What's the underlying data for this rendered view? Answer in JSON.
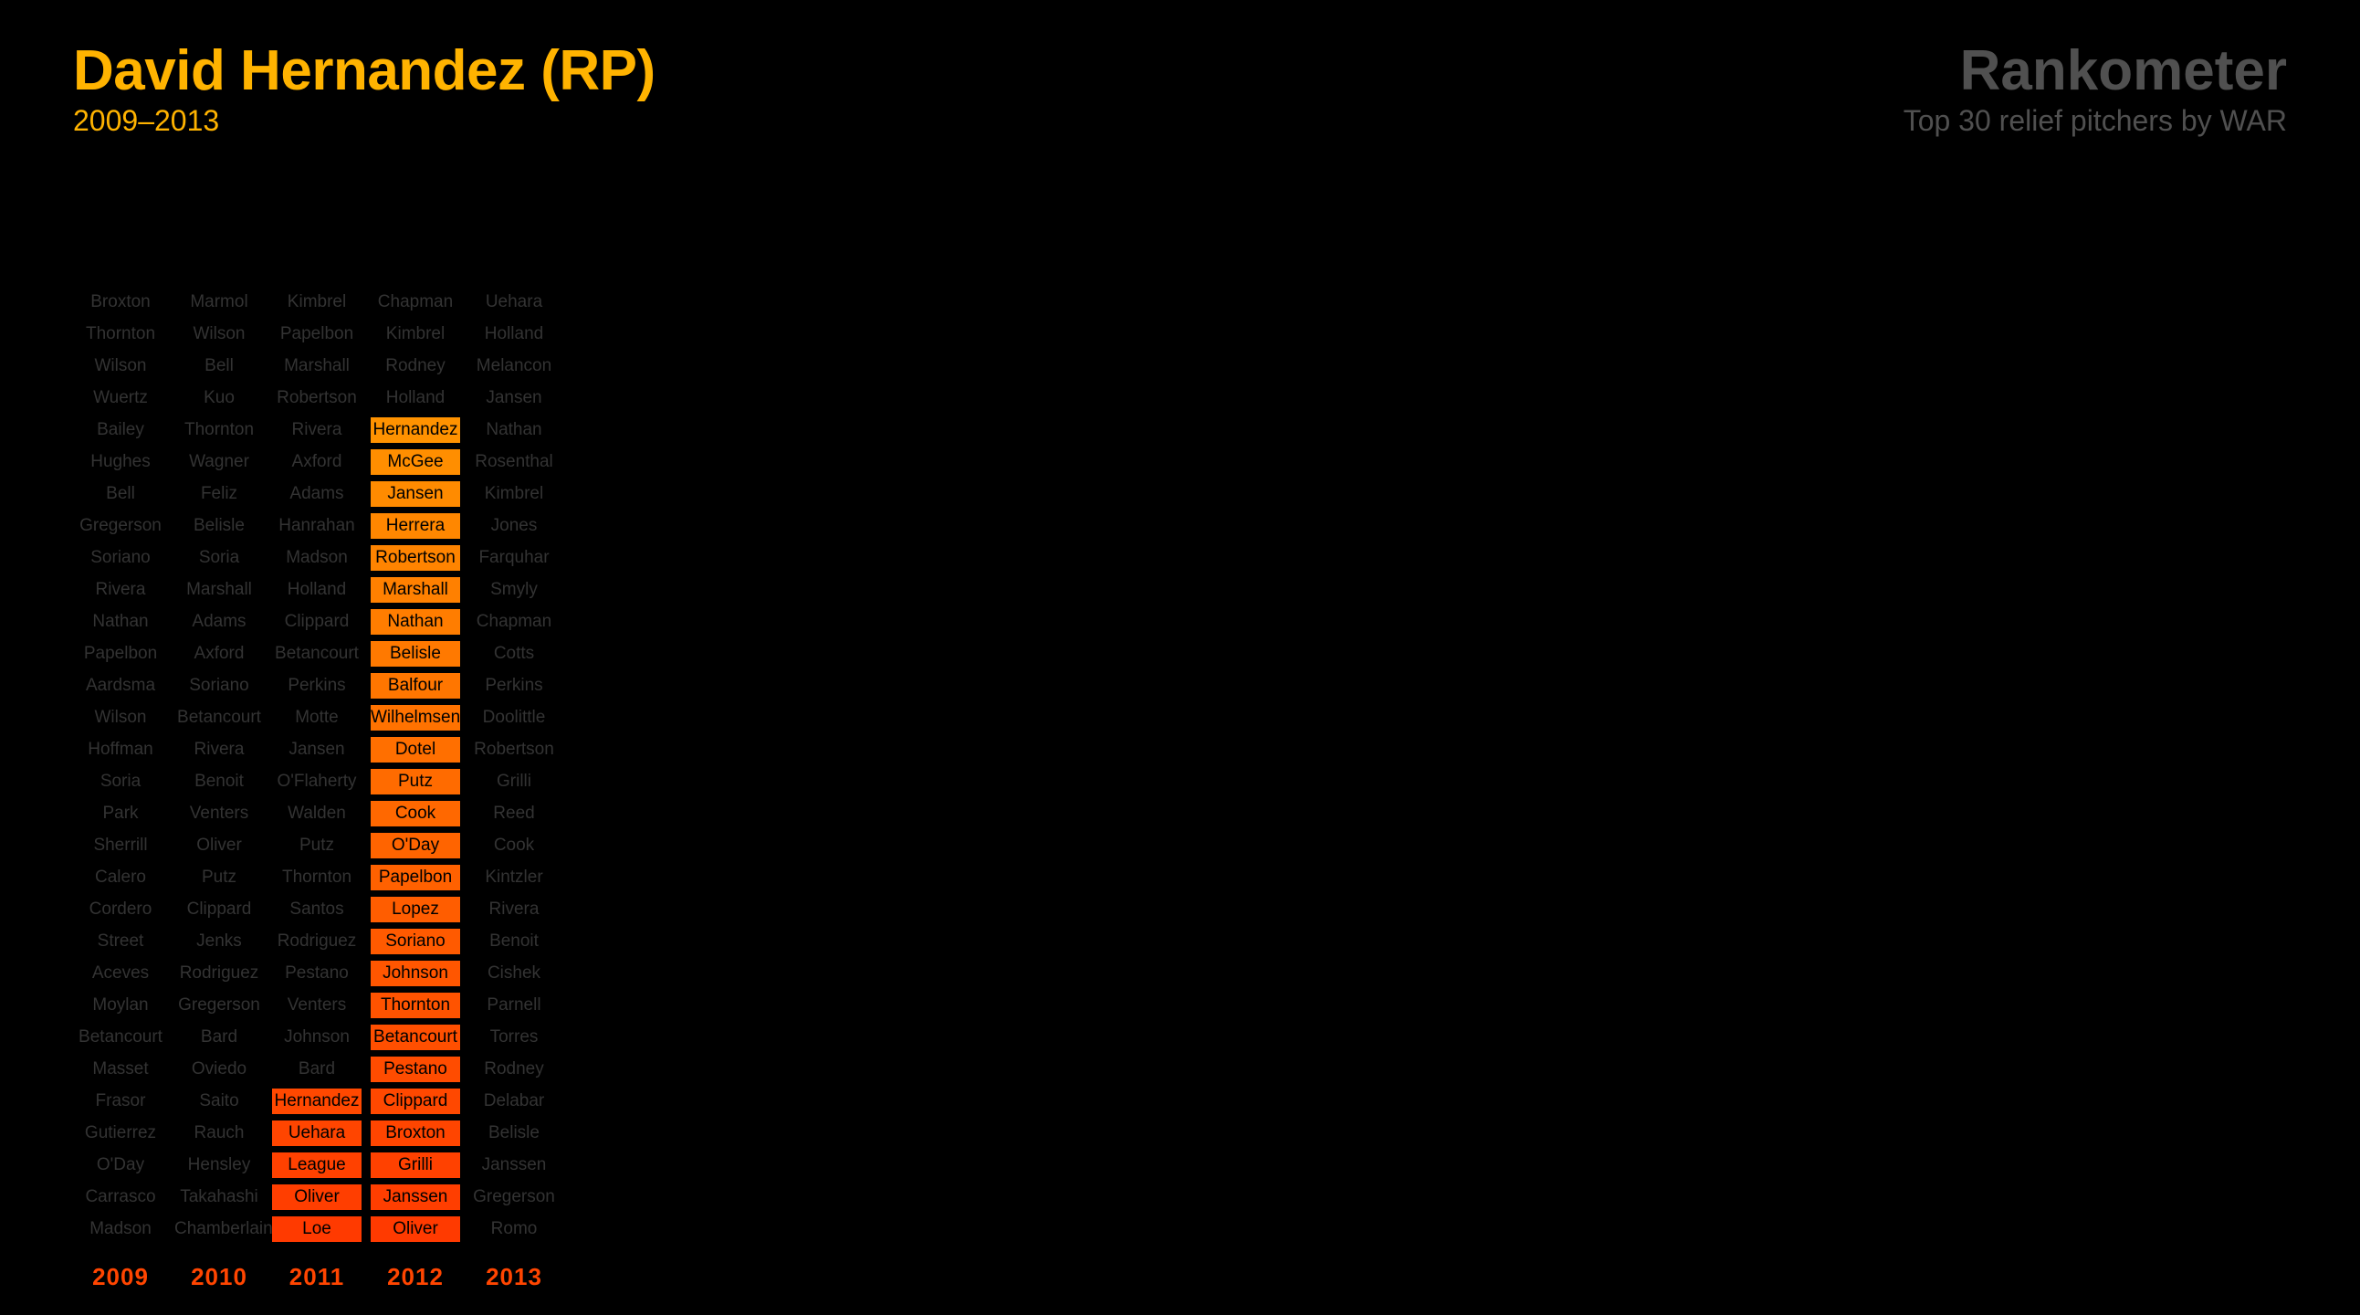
{
  "header": {
    "title": "David Hernandez (RP)",
    "subtitle": "2009–2013",
    "brand": "Rankometer",
    "tagline": "Top 30 relief pitchers by WAR"
  },
  "colors": {
    "title": "#ffb300",
    "muted_text": "#333333",
    "brand": "#505050",
    "highlight_top": "#ffa000",
    "highlight_bottom": "#ff3a00",
    "year_label": "#ff4500"
  },
  "chart_data": {
    "type": "table",
    "highlight_player": "Hernandez",
    "years": [
      "2009",
      "2010",
      "2011",
      "2012",
      "2013"
    ],
    "rankings": {
      "2009": [
        "Broxton",
        "Thornton",
        "Wilson",
        "Wuertz",
        "Bailey",
        "Hughes",
        "Bell",
        "Gregerson",
        "Soriano",
        "Rivera",
        "Nathan",
        "Papelbon",
        "Aardsma",
        "Wilson",
        "Hoffman",
        "Soria",
        "Park",
        "Sherrill",
        "Calero",
        "Cordero",
        "Street",
        "Aceves",
        "Moylan",
        "Betancourt",
        "Masset",
        "Frasor",
        "Gutierrez",
        "O'Day",
        "Carrasco",
        "Madson"
      ],
      "2010": [
        "Marmol",
        "Wilson",
        "Bell",
        "Kuo",
        "Thornton",
        "Wagner",
        "Feliz",
        "Belisle",
        "Soria",
        "Marshall",
        "Adams",
        "Axford",
        "Soriano",
        "Betancourt",
        "Rivera",
        "Benoit",
        "Venters",
        "Oliver",
        "Putz",
        "Clippard",
        "Jenks",
        "Rodriguez",
        "Gregerson",
        "Bard",
        "Oviedo",
        "Saito",
        "Rauch",
        "Hensley",
        "Takahashi",
        "Chamberlain"
      ],
      "2011": [
        "Kimbrel",
        "Papelbon",
        "Marshall",
        "Robertson",
        "Rivera",
        "Axford",
        "Adams",
        "Hanrahan",
        "Madson",
        "Holland",
        "Clippard",
        "Betancourt",
        "Perkins",
        "Motte",
        "Jansen",
        "O'Flaherty",
        "Walden",
        "Putz",
        "Thornton",
        "Santos",
        "Rodriguez",
        "Pestano",
        "Venters",
        "Johnson",
        "Bard",
        "Hernandez",
        "Uehara",
        "League",
        "Oliver",
        "Loe"
      ],
      "2012": [
        "Chapman",
        "Kimbrel",
        "Rodney",
        "Holland",
        "Hernandez",
        "McGee",
        "Jansen",
        "Herrera",
        "Robertson",
        "Marshall",
        "Nathan",
        "Belisle",
        "Balfour",
        "Wilhelmsen",
        "Dotel",
        "Putz",
        "Cook",
        "O'Day",
        "Papelbon",
        "Lopez",
        "Soriano",
        "Johnson",
        "Thornton",
        "Betancourt",
        "Pestano",
        "Clippard",
        "Broxton",
        "Grilli",
        "Janssen",
        "Oliver"
      ],
      "2013": [
        "Uehara",
        "Holland",
        "Melancon",
        "Jansen",
        "Nathan",
        "Rosenthal",
        "Kimbrel",
        "Jones",
        "Farquhar",
        "Smyly",
        "Chapman",
        "Cotts",
        "Perkins",
        "Doolittle",
        "Robertson",
        "Grilli",
        "Reed",
        "Cook",
        "Kintzler",
        "Rivera",
        "Benoit",
        "Cishek",
        "Parnell",
        "Torres",
        "Rodney",
        "Delabar",
        "Belisle",
        "Janssen",
        "Gregerson",
        "Romo"
      ]
    },
    "highlighted_cells": {
      "2011": [
        26,
        27,
        28,
        29,
        30
      ],
      "2012": [
        5,
        6,
        7,
        8,
        9,
        10,
        11,
        12,
        13,
        14,
        15,
        16,
        17,
        18,
        19,
        20,
        21,
        22,
        23,
        24,
        25,
        26,
        27,
        28,
        29,
        30
      ]
    },
    "rank_range": [
      1,
      30
    ]
  }
}
